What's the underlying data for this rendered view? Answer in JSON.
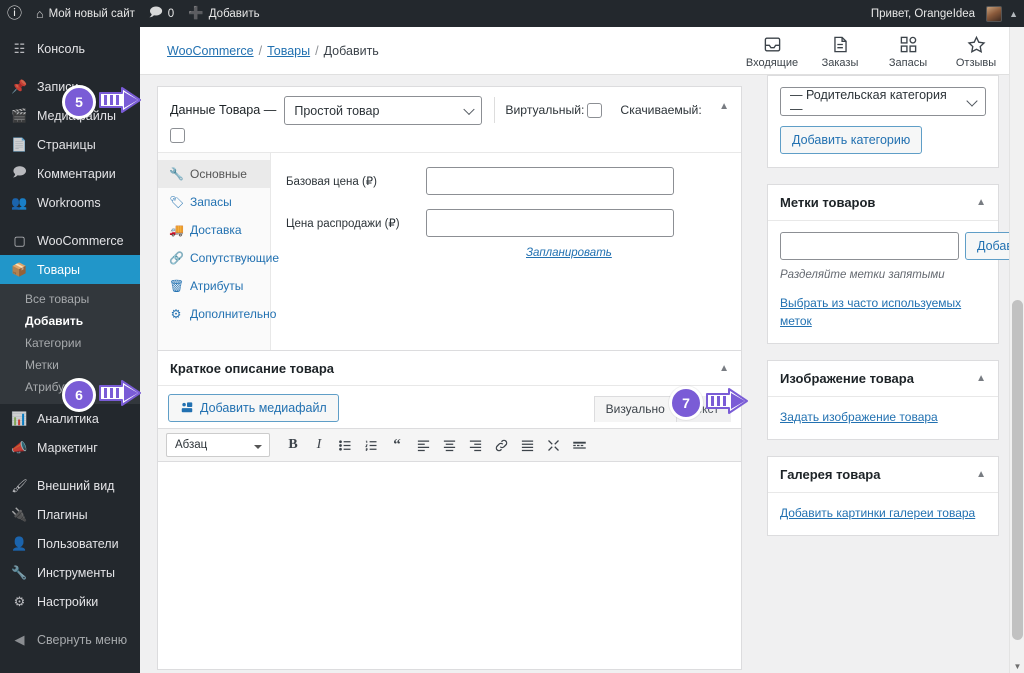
{
  "adminbar": {
    "wp_logo_icon": "wordpress-icon",
    "site_icon": "home-icon",
    "site_name": "Мой новый сайт",
    "comments_icon": "comment-bubble-icon",
    "comments_count": "0",
    "new_icon": "plus-icon",
    "new_label": "Добавить",
    "greeting": "Привет, OrangeIdea",
    "avatar_icon": "user-avatar",
    "collapse_icon": "caret-up-icon"
  },
  "sidebar": {
    "items": [
      {
        "label": "Консоль",
        "icon": "dashboard-icon",
        "current": false
      },
      {
        "label": "Записи",
        "icon": "pin-icon",
        "current": false
      },
      {
        "label": "Медиафайлы",
        "icon": "media-icon",
        "current": false
      },
      {
        "label": "Страницы",
        "icon": "pages-icon",
        "current": false
      },
      {
        "label": "Комментарии",
        "icon": "comments-icon",
        "current": false
      },
      {
        "label": "Workrooms",
        "icon": "groups-icon",
        "current": false
      },
      {
        "label": "WooCommerce",
        "icon": "woocommerce-icon",
        "current": false
      },
      {
        "label": "Товары",
        "icon": "products-box-icon",
        "current": true
      }
    ],
    "submenu": [
      {
        "label": "Все товары",
        "current": false
      },
      {
        "label": "Добавить",
        "current": true
      },
      {
        "label": "Категории",
        "current": false
      },
      {
        "label": "Метки",
        "current": false
      },
      {
        "label": "Атрибуты",
        "current": false
      }
    ],
    "items_lower": [
      {
        "label": "Аналитика",
        "icon": "chart-bars-icon"
      },
      {
        "label": "Маркетинг",
        "icon": "megaphone-icon"
      },
      {
        "label": "Внешний вид",
        "icon": "paintbrush-icon"
      },
      {
        "label": "Плагины",
        "icon": "plug-icon"
      },
      {
        "label": "Пользователи",
        "icon": "user-icon"
      },
      {
        "label": "Инструменты",
        "icon": "wrench-icon"
      },
      {
        "label": "Настройки",
        "icon": "sliders-icon"
      }
    ],
    "collapse": {
      "label": "Свернуть меню",
      "icon": "collapse-arrow-icon"
    }
  },
  "header": {
    "breadcrumb": [
      {
        "label": "WooCommerce",
        "link": true
      },
      {
        "label": "Товары",
        "link": true
      },
      {
        "label": "Добавить",
        "link": false
      }
    ],
    "separator": "/",
    "nav": [
      {
        "label": "Входящие",
        "icon": "inbox-icon"
      },
      {
        "label": "Заказы",
        "icon": "orders-page-icon"
      },
      {
        "label": "Запасы",
        "icon": "stock-grid-icon"
      },
      {
        "label": "Отзывы",
        "icon": "star-icon"
      }
    ]
  },
  "product_data": {
    "title": "Данные Товара —",
    "type_selected": "Простой товар",
    "type_chevron_icon": "chevron-down-icon",
    "virtual_label": "Виртуальный:",
    "downloadable_label": "Скачиваемый:",
    "collapse_icon": "caret-up-icon",
    "tabs": [
      {
        "label": "Основные",
        "icon": "wrench-icon",
        "active": true
      },
      {
        "label": "Запасы",
        "icon": "tag-icon",
        "active": false
      },
      {
        "label": "Доставка",
        "icon": "truck-icon",
        "active": false
      },
      {
        "label": "Сопутствующие",
        "icon": "link-icon",
        "active": false
      },
      {
        "label": "Атрибуты",
        "icon": "attributes-icon",
        "active": false
      },
      {
        "label": "Дополнительно",
        "icon": "gear-icon",
        "active": false
      }
    ],
    "fields": [
      {
        "label": "Базовая цена (₽)",
        "value": ""
      },
      {
        "label": "Цена распродажи (₽)",
        "value": ""
      }
    ],
    "schedule_link": "Запланировать"
  },
  "short_description": {
    "title": "Краткое описание товара",
    "collapse_icon": "caret-up-icon",
    "add_media_label": "Добавить медиафайл",
    "add_media_icon": "media-add-icon",
    "editor_tabs": [
      {
        "label": "Визуально",
        "active": true
      },
      {
        "label": "Текст",
        "active": false
      }
    ],
    "format_select": "Абзац",
    "toolbar_icons": [
      "bold-icon",
      "italic-icon",
      "bulleted-list-icon",
      "numbered-list-icon",
      "blockquote-icon",
      "align-left-icon",
      "align-center-icon",
      "align-right-icon",
      "insert-link-icon",
      "read-more-icon",
      "fullscreen-icon",
      "toolbar-toggle-icon"
    ],
    "content": ""
  },
  "sidebar_panels": {
    "categories": {
      "parent_select": "— Родительская категория —",
      "chevron_icon": "chevron-down-icon",
      "add_button": "Добавить категорию"
    },
    "tags": {
      "title": "Метки товаров",
      "collapse_icon": "caret-up-icon",
      "input_value": "",
      "add_button": "Добавить",
      "hint": "Разделяйте метки запятыми",
      "choose_link": "Выбрать из часто используемых меток"
    },
    "product_image": {
      "title": "Изображение товара",
      "collapse_icon": "caret-up-icon",
      "set_link": "Задать изображение товара"
    },
    "product_gallery": {
      "title": "Галерея товара",
      "collapse_icon": "caret-up-icon",
      "add_link": "Добавить картинки галереи товара"
    }
  },
  "markers": [
    {
      "number": "5"
    },
    {
      "number": "6"
    },
    {
      "number": "7"
    }
  ],
  "scrollbar": {
    "arrow_icon": "caret-down-icon"
  },
  "colors": {
    "admin_dark": "#23282d",
    "admin_submenu": "#32373c",
    "current_blue": "#2196c9",
    "link_blue": "#2271b1",
    "marker_purple": "#7a5cd6"
  }
}
